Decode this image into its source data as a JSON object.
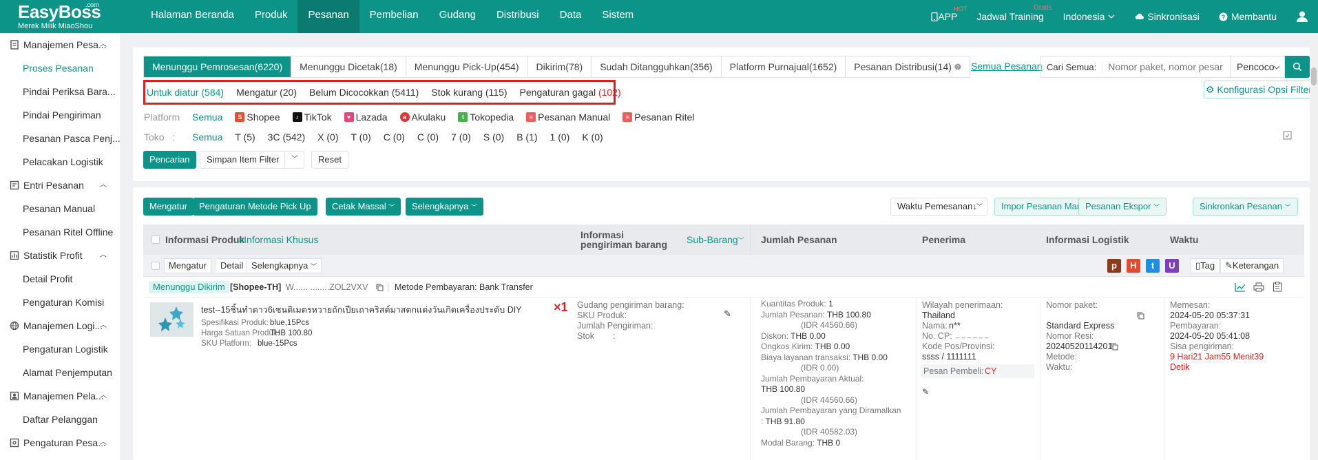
{
  "app": {
    "logo_main": "EasyBoss",
    "logo_com": ".com",
    "logo_sub": "Merek Milik MiaoShou"
  },
  "topnav": [
    "Halaman Beranda",
    "Produk",
    "Pesanan",
    "Pembelian",
    "Gudang",
    "Distribusi",
    "Data",
    "Sistem"
  ],
  "topnav_active": "Pesanan",
  "topright": {
    "app": "APP",
    "app_sup": "HOT",
    "training": "Jadwal Training",
    "training_sup": "Gratis",
    "language": "Indonesia",
    "sync": "Sinkronisasi",
    "help": "Membantu"
  },
  "sidebar": {
    "groups": [
      {
        "label": "Manajemen Pesa...",
        "items": [
          "Proses Pesanan",
          "Pindai Periksa Bara...",
          "Pindai Pengiriman",
          "Pesanan Pasca Penj...",
          "Pelacakan Logistik"
        ]
      },
      {
        "label": "Entri Pesanan",
        "items": [
          "Pesanan Manual",
          "Pesanan Ritel Offline"
        ]
      },
      {
        "label": "Statistik Profit",
        "items": [
          "Detail Profit",
          "Pengaturan Komisi"
        ]
      },
      {
        "label": "Manajemen Logi...",
        "items": [
          "Pengaturan Logistik",
          "Alamat Penjemputan"
        ]
      },
      {
        "label": "Manajemen Pela...",
        "items": [
          "Daftar Pelanggan"
        ]
      },
      {
        "label": "Pengaturan Pesa...",
        "items": []
      }
    ],
    "active_item": "Proses Pesanan"
  },
  "tabs": [
    "Menunggu Pemrosesan(6220)",
    "Menunggu Dicetak(18)",
    "Menunggu Pick-Up(454)",
    "Dikirim(78)",
    "Sudah Ditangguhkan(356)",
    "Platform Purnajual(1652)",
    "Pesanan Distribusi(14)"
  ],
  "all_orders": "Semua Pesanan",
  "search": {
    "label": "Cari Semua:",
    "placeholder": "Nomor paket, nomor pesar",
    "select": "Pencoco"
  },
  "config_button": "Konfigurasi Opsi Filter",
  "subtabs": [
    {
      "label": "Untuk diatur",
      "count": "(584)"
    },
    {
      "label": "Mengatur",
      "count": "(20)"
    },
    {
      "label": "Belum Dicocokkan",
      "count": "(5411)"
    },
    {
      "label": "Stok kurang",
      "count": "(115)"
    },
    {
      "label": "Pengaturan gagal",
      "count": "(102)"
    }
  ],
  "platform": {
    "label": "Platform",
    "options": [
      "Semua",
      "Shopee",
      "TikTok",
      "Lazada",
      "Akulaku",
      "Tokopedia",
      "Pesanan Manual",
      "Pesanan Ritel"
    ]
  },
  "store": {
    "label": "Toko",
    "options": [
      "Semua",
      "T (5)",
      "3C (542)",
      "X (0)",
      "T (0)",
      "C (0)",
      "C (0)",
      "7 (0)",
      "S (0)",
      "B (1)",
      "1 (0)",
      "K (0)"
    ]
  },
  "filter_buttons": {
    "search": "Pencarian",
    "save_filter": "Simpan Item Filter",
    "reset": "Reset"
  },
  "actions": {
    "arrange": "Mengatur",
    "pickup_method": "Pengaturan Metode Pick Up",
    "mass_print": "Cetak Massal",
    "more": "Selengkapnya",
    "sort": "Waktu Pemesanan",
    "import_manual": "Impor Pesanan Manual",
    "export": "Pesanan Ekspor",
    "sync": "Sinkronkan Pesanan"
  },
  "table_headers": {
    "product": "Informasi Produk",
    "special": "Informasi Khusus",
    "shipping": "Informasi pengiriman barang",
    "subitem": "Sub-Barang",
    "qty": "Jumlah Pesanan",
    "receiver": "Penerima",
    "logistics": "Informasi Logistik",
    "time": "Waktu"
  },
  "row_actions": {
    "arrange": "Mengatur",
    "detail": "Detail",
    "more": "Selengkapnya",
    "tag": "Tag",
    "note": "Keterangan",
    "tag_letters": [
      "p",
      "H",
      "t",
      "U"
    ],
    "tag_colors": [
      "#8b3a1a",
      "#e8492c",
      "#1f8fe0",
      "#7b3fbf"
    ]
  },
  "order": {
    "status": "Menunggu Dikirim",
    "shop": "[Shopee-TH]",
    "order_no": "W...... ........ZOL2VXV",
    "payment": "Metode Pembayaran: Bank Transfer",
    "product_title": "test--15ชิ้นทำดาว6เซนติเมตรหวายถักเปียเถาคริสต์มาสตกแต่งวันเกิดเครื่องประดับ DIY",
    "spec_label": "Spesifikasi Produk:",
    "spec": "blue,15Pcs",
    "price_label": "Harga Satuan Produk:",
    "price": "THB 100.80",
    "sku_label": "SKU Platform:",
    "sku": "blue-15Pcs",
    "qty_mark": "×1",
    "ship_warehouse": "Gudang pengiriman barang:",
    "ship_sku": "SKU Produk:",
    "ship_qty": "Jumlah Pengiriman:",
    "ship_stock": "Stok",
    "ship_stock_val": ":",
    "amounts": [
      {
        "label": "Kuantitas Produk:",
        "value": "1"
      },
      {
        "label": "Jumlah Pesanan:",
        "value": "THB 100.80"
      },
      {
        "label": "",
        "value": "(IDR 44560.66)"
      },
      {
        "label": "Diskon:",
        "value": "THB 0.00"
      },
      {
        "label": "Ongkos Kirim:",
        "value": "THB 0.00"
      },
      {
        "label": "Biaya layanan transaksi:",
        "value": "THB 0.00"
      },
      {
        "label": "",
        "value": "(IDR 0.00)"
      },
      {
        "label": "Jumlah Pembayaran Aktual:",
        "value": ""
      },
      {
        "label": "",
        "value": "THB 100.80"
      },
      {
        "label": "",
        "value": "(IDR 44560.66)"
      },
      {
        "label": "Jumlah Pembayaran yang Diramalkan",
        "value": ""
      },
      {
        "label": ":",
        "value": "THB 91.80"
      },
      {
        "label": "",
        "value": "(IDR 40582.03)"
      },
      {
        "label": "Modal Barang:",
        "value": "THB 0"
      }
    ],
    "receiver": {
      "region_label": "Wilayah penerimaan:",
      "region": "Thailand",
      "name_label": "Nama:",
      "name": "n**",
      "cp_label": "No. CP:",
      "cp": "_ _ _ _ _ _",
      "postal_label": "Kode Pos/Provinsi:",
      "postal": "ssss / 1111111",
      "buyer_msg_label": "Pesan Pembeli:",
      "buyer_msg": "CY"
    },
    "logistics": {
      "package_label": "Nomor paket:",
      "carrier": "Standard Express",
      "resi_label": "Nomor Resi:",
      "resi": "20240520114201",
      "method_label": "Metode:",
      "time_label": "Waktu:"
    },
    "times": {
      "order_label": "Memesan:",
      "order": "2024-05-20 05:37:31",
      "pay_label": "Pembayaran:",
      "pay": "2024-05-20 05:41:08",
      "remain_label": "Sisa pengiriman:",
      "remain": "9 Hari21 Jam55 Menit39",
      "remain2": "Detik"
    }
  },
  "colors": {
    "primary": "#0d9488",
    "alert": "#e02020"
  }
}
